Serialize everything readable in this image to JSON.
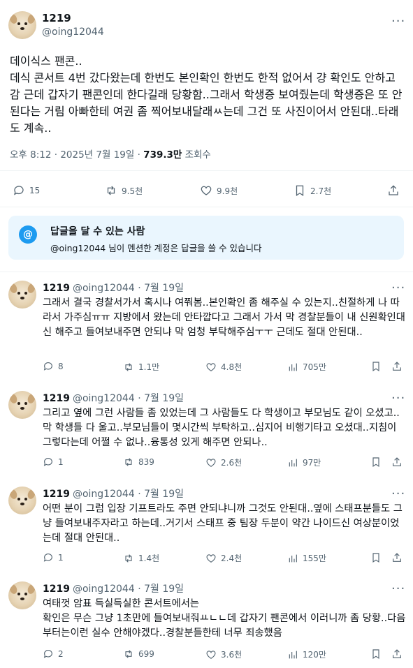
{
  "main": {
    "display_name": "1219",
    "handle": "@oing12044",
    "text": "데이식스 팬콘..\n데식 콘서트 4번 갔다왔는데 한번도 본인확인 한번도 한적 없어서 걍 확인도 안하고 감 근데 갑자기 팬콘인데 한다길래 당황함..그래서 학생증 보여줬는데 학생증은 또 안된다는 거림 아빠한테 여권 좀 찍어보내달래ㅆ는데 그건 또 사진이어서 안된대..타래도 계속..",
    "time": "오후 8:12",
    "date": "2025년 7월 19일",
    "views": "739.3만",
    "views_label": "조회수",
    "stats": {
      "replies": "15",
      "retweets": "9.5천",
      "likes": "9.9천",
      "bookmarks": "2.7천"
    }
  },
  "reply_restriction": {
    "title": "답글을 달 수 있는 사람",
    "desc": "@oing12044 님이 멘션한 계정은 답글을 쓸 수 있습니다"
  },
  "replies": [
    {
      "name": "1219",
      "handle": "@oing12044",
      "date": "· 7월 19일",
      "text": "그래서 결국 경찰서가서 혹시나 여쭤봄..본인확인 좀 해주실 수 있는지..친절하게 나 따라서 가주심ㅠㅠ 지방에서 왔는데 안타깝다고 그래서 가서 막 경찰분들이 내 신원확인대신 해주고 들여보내주면 안되냐 막 엄청 부탁해주심ㅜㅜ 근데도 절대 안된대..",
      "replies": "8",
      "retweets": "1.1만",
      "likes": "4.8천",
      "views": "705만"
    },
    {
      "name": "1219",
      "handle": "@oing12044",
      "date": "· 7월 19일",
      "text": "그리고 옆에 그런 사람들 좀 있었는데 그 사람들도 다 학생이고 부모님도 같이 오셨고..막 학생들 다 울고..부모님들이 몇시간씩 부탁하고..심지어 비행기타고 오셨대..지침이 그렇다는데 어쩔 수 없나..융통성 있게 해주면 안되나..",
      "replies": "1",
      "retweets": "839",
      "likes": "2.6천",
      "views": "97만"
    },
    {
      "name": "1219",
      "handle": "@oing12044",
      "date": "· 7월 19일",
      "text": "어떤 분이 그럼 입장 기프트라도 주면 안되냐니까 그것도 안된대..옆에 스태프분들도 그냥 들여보내주자라고 하는데..거기서 스태프 중 팀장 두분이 약간 나이드신 여상분이었는데 절대 안된대..",
      "replies": "1",
      "retweets": "1.4천",
      "likes": "2.4천",
      "views": "155만"
    },
    {
      "name": "1219",
      "handle": "@oing12044",
      "date": "· 7월 19일",
      "text": "여태껏 암표 득실득실한 콘서트에서는\n확인은 무슨 그냥 1초만에 들여보내줘ㅛㄴㄴ데 갑자기 팬콘에서 이러니까 좀 당황..다음부터는이런 실수 안해야겠다..경찰분들한테 너무 죄송했음",
      "replies": "2",
      "retweets": "699",
      "likes": "3.6천",
      "views": "120만"
    }
  ]
}
